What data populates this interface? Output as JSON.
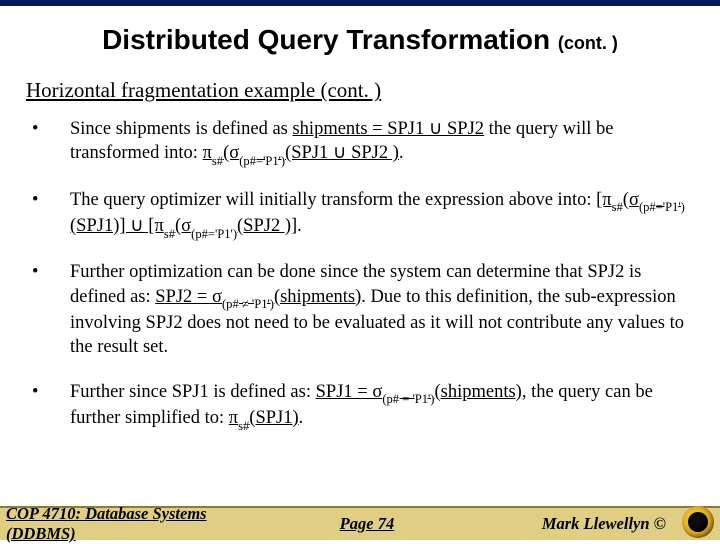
{
  "title": {
    "main": "Distributed Query Transformation",
    "cont": "(cont. )"
  },
  "subtitle": "Horizontal fragmentation example (cont. )",
  "bullets": [
    {
      "html": "Since shipments is defined as  <span class='u'>shipments = SPJ1 ∪ SPJ2</span>  the query will be transformed into: <span class='u'>π<span class='sub'>s#</span>(σ<span class='sub'>(p#='P1')</span>(SPJ1 ∪ SPJ2 )</span>."
    },
    {
      "html": "The query optimizer will initially transform the expression above into: <span class='u'>[π<span class='sub'>s#</span>(σ<span class='sub'>(p#='P1')</span>(SPJ1)] ∪ [π<span class='sub'>s#</span>(σ<span class='sub'>(p#='P1')</span>(SPJ2 )]</span>."
    },
    {
      "html": "Further optimization can be done since the system can determine that SPJ2 is defined as: <span class='u'>SPJ2 = σ<span class='sub'>(p# ≠ 'P1')</span>(shipments)</span>.  Due to this definition, the sub-expression involving SPJ2 does not need to be evaluated as it will not contribute any values to the result set."
    },
    {
      "html": "Further since SPJ1 is defined as: <span class='u'>SPJ1 = σ<span class='sub'>(p# = 'P1')</span>(shipments)</span>, the query can be further simplified to: <span class='u'>π<span class='sub'>s#</span>(SPJ1)</span>."
    }
  ],
  "footer": {
    "course": "COP 4710: Database Systems  (DDBMS)",
    "page": "Page 74",
    "author": "Mark Llewellyn ©"
  }
}
